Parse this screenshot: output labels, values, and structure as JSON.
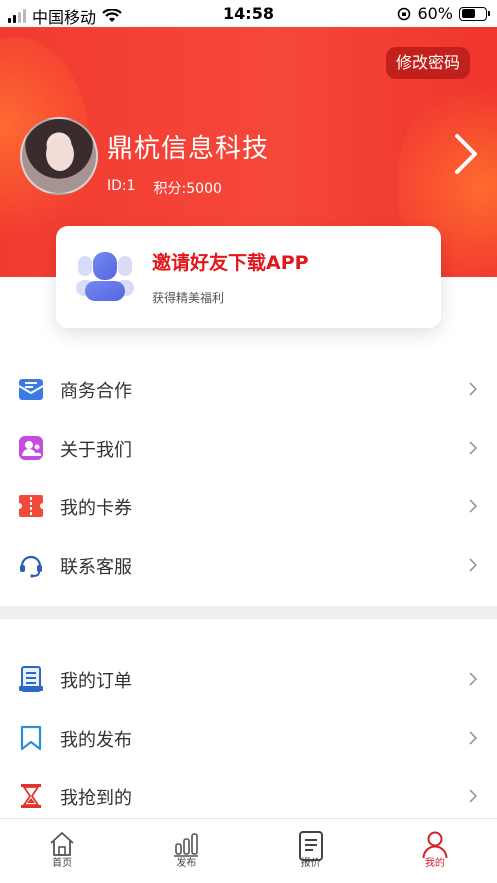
{
  "status_bar": {
    "carrier": "中国移动",
    "time": "14:58",
    "battery": "60%",
    "battery_level": 0.6
  },
  "header": {
    "change_password_label": "修改密码",
    "company_name": "鼎杭信息科技",
    "id_text": "ID:1",
    "points_text": "积分:5000"
  },
  "invite": {
    "title": "邀请好友下载APP",
    "subtitle": "获得精美福利"
  },
  "menu_group_1": [
    {
      "label": "商务合作",
      "icon": "business-cooperation-icon",
      "color": "#3b7be6"
    },
    {
      "label": "关于我们",
      "icon": "about-us-icon",
      "color": "#c44ce0"
    },
    {
      "label": "我的卡券",
      "icon": "coupon-icon",
      "color": "#f04a3a"
    },
    {
      "label": "联系客服",
      "icon": "headset-icon",
      "color": "#2a5fb4"
    }
  ],
  "menu_group_2": [
    {
      "label": "我的订单",
      "icon": "order-list-icon",
      "color": "#2c66c7"
    },
    {
      "label": "我的发布",
      "icon": "bookmark-icon",
      "color": "#2a8fd6"
    },
    {
      "label": "我抢到的",
      "icon": "hourglass-icon",
      "color": "#e0352b"
    }
  ],
  "tabbar": {
    "tabs": [
      {
        "label": "首页",
        "icon": "home-icon"
      },
      {
        "label": "发布",
        "icon": "bar-chart-icon"
      },
      {
        "label": "报价",
        "icon": "document-icon"
      },
      {
        "label": "我的",
        "icon": "profile-icon"
      }
    ],
    "active_index": 3
  },
  "colors": {
    "brand_red": "#f23b30",
    "accent_red": "#e3171b",
    "active_tab": "#d42027"
  }
}
